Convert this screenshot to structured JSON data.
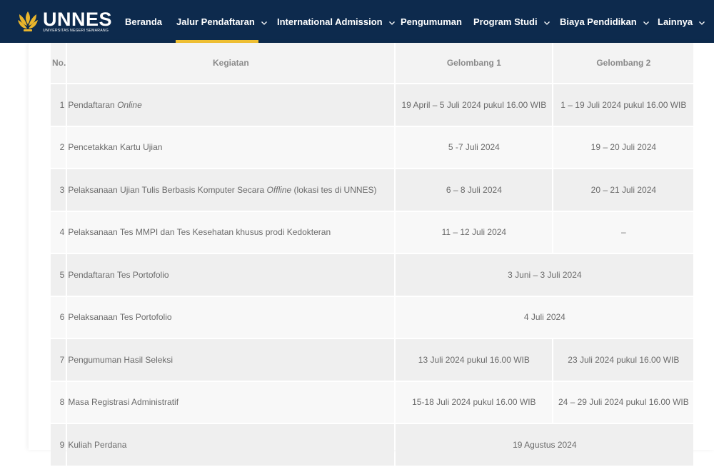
{
  "brand": {
    "name": "UNNES",
    "subtitle": "UNIVERSITAS NEGERI SEMARANG"
  },
  "nav": {
    "items": [
      {
        "label": "Beranda",
        "dropdown": false
      },
      {
        "label": "Jalur Pendaftaran",
        "dropdown": true,
        "active": true
      },
      {
        "label": "International Admission",
        "dropdown": true
      },
      {
        "label": "Pengumuman",
        "dropdown": false
      },
      {
        "label": "Program Studi",
        "dropdown": true
      },
      {
        "label": "Biaya Pendidikan",
        "dropdown": true
      },
      {
        "label": "Lainnya",
        "dropdown": true
      }
    ]
  },
  "table": {
    "headers": [
      "No.",
      "Kegiatan",
      "Gelombang 1",
      "Gelombang 2"
    ],
    "rows": [
      {
        "no": "1",
        "activity_pre": "Pendaftaran ",
        "activity_em": "Online",
        "activity_post": "",
        "g1": "19 April – 5 Juli 2024 pukul 16.00 WIB",
        "g2": "1 – 19 Juli 2024 pukul 16.00 WIB"
      },
      {
        "no": "2",
        "activity_pre": "Pencetakkan Kartu Ujian",
        "activity_em": "",
        "activity_post": "",
        "g1": "5 -7 Juli 2024",
        "g2": "19 – 20 Juli 2024"
      },
      {
        "no": "3",
        "activity_pre": "Pelaksanaan Ujian Tulis Berbasis Komputer Secara ",
        "activity_em": "Offline",
        "activity_post": " (lokasi tes di UNNES)",
        "g1": "6 – 8 Juli 2024",
        "g2": "20 – 21 Juli 2024"
      },
      {
        "no": "4",
        "activity_pre": "Pelaksanaan Tes MMPI dan Tes Kesehatan khusus prodi Kedokteran",
        "activity_em": "",
        "activity_post": "",
        "g1": "11 – 12 Juli 2024",
        "g2": "–"
      },
      {
        "no": "5",
        "activity_pre": "Pendaftaran Tes Portofolio",
        "activity_em": "",
        "activity_post": "",
        "merged": "3 Juni – 3 Juli 2024"
      },
      {
        "no": "6",
        "activity_pre": "Pelaksanaan Tes Portofolio",
        "activity_em": "",
        "activity_post": "",
        "merged": "4 Juli 2024"
      },
      {
        "no": "7",
        "activity_pre": "Pengumuman Hasil Seleksi",
        "activity_em": "",
        "activity_post": "",
        "g1": "13 Juli 2024 pukul 16.00 WIB",
        "g2": "23 Juli 2024 pukul 16.00 WIB"
      },
      {
        "no": "8",
        "activity_pre": "Masa Registrasi Administratif",
        "activity_em": "",
        "activity_post": "",
        "g1": "15-18 Juli 2024 pukul 16.00 WIB",
        "g2": "24 – 29 Juli 2024 pukul 16.00 WIB"
      },
      {
        "no": "9",
        "activity_pre": "Kuliah Perdana",
        "activity_em": "",
        "activity_post": "",
        "merged": "19 Agustus 2024"
      }
    ]
  },
  "colors": {
    "navbar": "#0d2a4d",
    "active_underline": "#f2c233",
    "logo_gold": "#e9b52c"
  }
}
